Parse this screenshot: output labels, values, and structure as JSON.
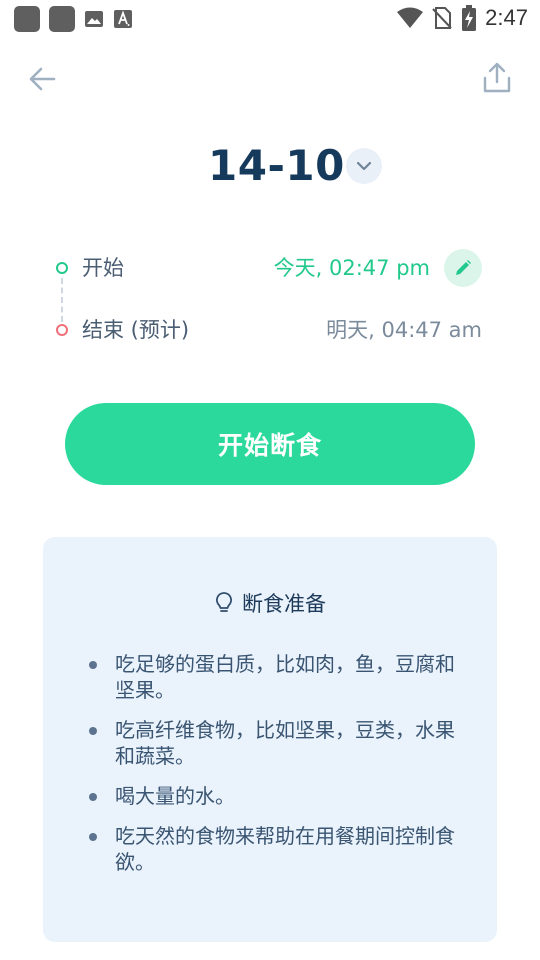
{
  "status_bar": {
    "time": "2:47",
    "icons": [
      "app-icon",
      "app-icon",
      "image-icon",
      "font-icon",
      "wifi-icon",
      "no-sim-icon",
      "battery-charging-icon"
    ]
  },
  "header": {
    "back_icon": "arrow-left-icon",
    "share_icon": "share-icon"
  },
  "plan": {
    "title": "14-10",
    "dropdown_icon": "chevron-down-icon"
  },
  "schedule": {
    "start_label": "开始",
    "start_value": "今天, 02:47 pm",
    "edit_icon": "pencil-icon",
    "end_label": "结束 (预计)",
    "end_value": "明天, 04:47 am"
  },
  "actions": {
    "start_fast_label": "开始断食"
  },
  "tips": {
    "icon": "lightbulb-icon",
    "title": "断食准备",
    "items": [
      "吃足够的蛋白质，比如肉，鱼，豆腐和坚果。",
      "吃高纤维食物，比如坚果，豆类，水果和蔬菜。",
      "喝大量的水。",
      "吃天然的食物来帮助在用餐期间控制食欲。"
    ]
  },
  "colors": {
    "accent_green": "#2bd99c",
    "start_green": "#22c98c",
    "end_red": "#f0707a",
    "title_navy": "#163a5c",
    "card_bg": "#eaf3fc"
  }
}
